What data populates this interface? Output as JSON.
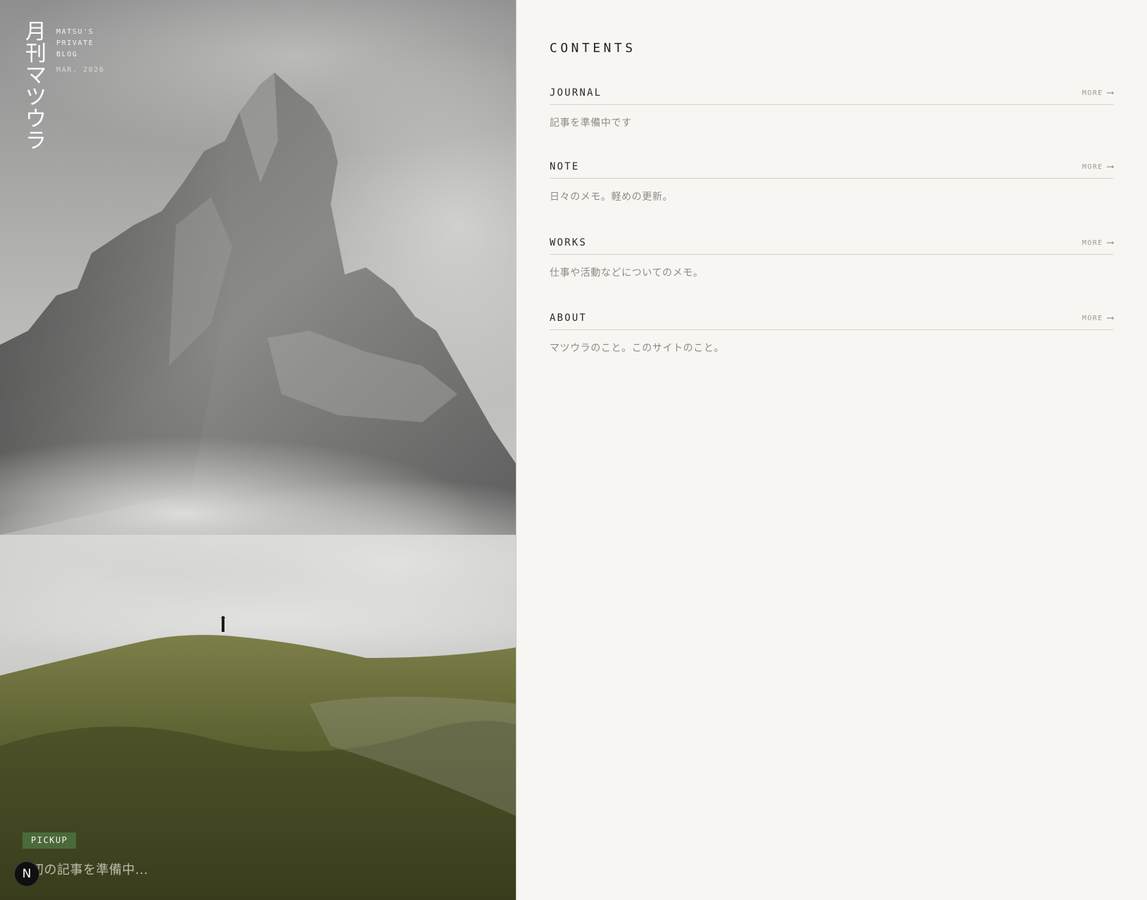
{
  "hero": {
    "brand_vertical": "月刊マツウラ",
    "brand_lines": [
      "MATSU'S",
      "PRIVATE",
      "BLOG"
    ],
    "issue_date": "MAR. 2026",
    "pickup": {
      "badge": "PICKUP",
      "title": "初の記事を準備中..."
    },
    "fab_label": "N"
  },
  "contents": {
    "heading": "CONTENTS",
    "sections": [
      {
        "title": "JOURNAL",
        "more": "MORE",
        "description": "記事を準備中です"
      },
      {
        "title": "NOTE",
        "more": "MORE",
        "description": "日々のメモ。軽めの更新。"
      },
      {
        "title": "WORKS",
        "more": "MORE",
        "description": "仕事や活動などについてのメモ。"
      },
      {
        "title": "ABOUT",
        "more": "MORE",
        "description": "マツウラのこと。このサイトのこと。"
      }
    ]
  },
  "icons": {
    "more_arrow": "arrow-right-icon",
    "fab": "next-logo-icon"
  },
  "colors": {
    "page_background": "#f7f6f2",
    "pickup_badge": "#4b6a3c",
    "heading_text": "#222222",
    "muted_text": "#8c8a85"
  }
}
